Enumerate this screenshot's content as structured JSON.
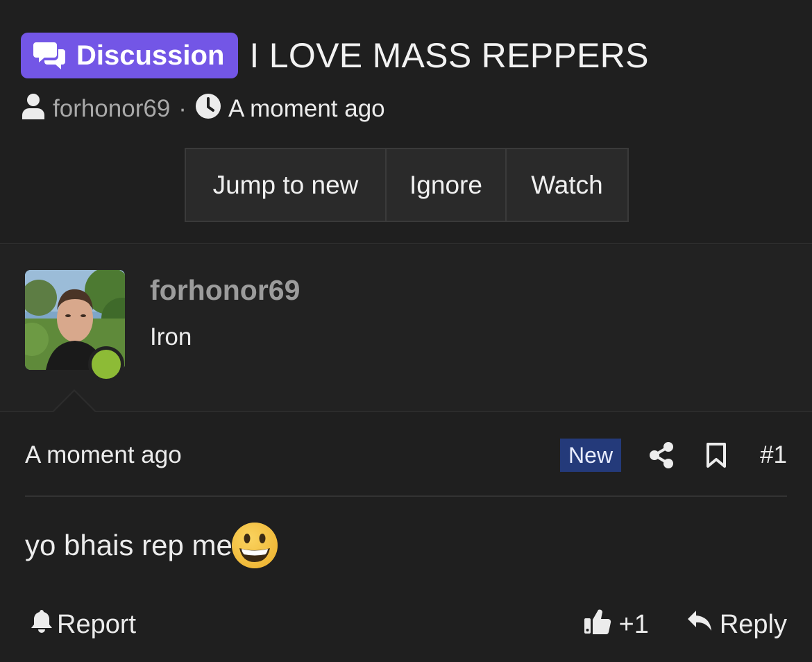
{
  "thread": {
    "badge_label": "Discussion",
    "title": "I LOVE MASS REPPERS",
    "author": "forhonor69",
    "separator": "·",
    "time": "A moment ago"
  },
  "buttons": {
    "jump": "Jump to new",
    "ignore": "Ignore",
    "watch": "Watch"
  },
  "user": {
    "name": "forhonor69",
    "title": "Iron",
    "online": true
  },
  "post": {
    "time": "A moment ago",
    "new_badge": "New",
    "number": "#1",
    "body": "yo bhais rep me",
    "emoji": "grinning-face"
  },
  "actions": {
    "report": "Report",
    "like_count": "+1",
    "reply": "Reply"
  },
  "colors": {
    "background": "#1f1f1f",
    "badge": "#7356e6",
    "new_badge": "#243a7a",
    "online": "#8dbb36"
  }
}
